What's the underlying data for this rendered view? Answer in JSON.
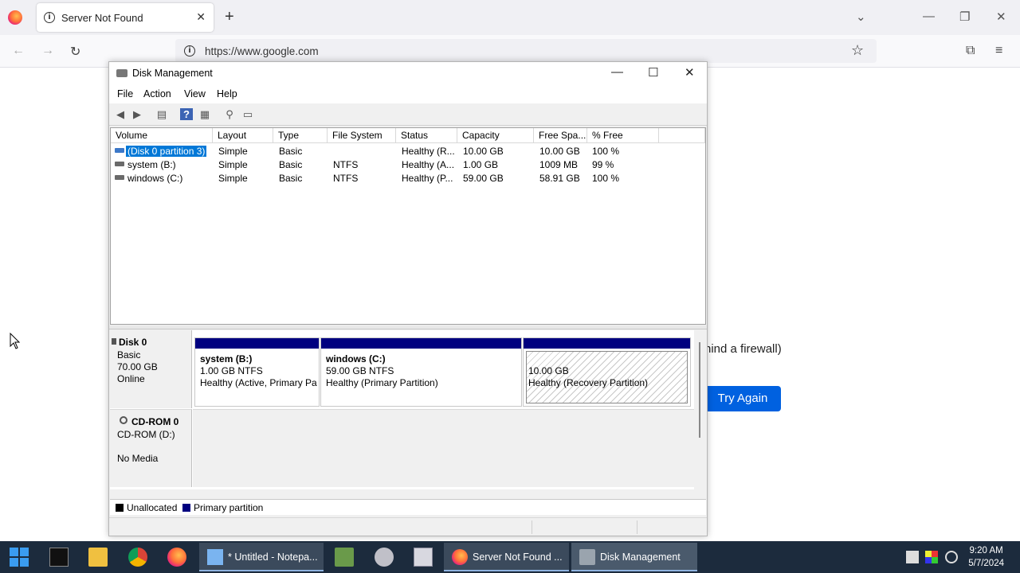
{
  "browser": {
    "tab_title": "Server Not Found",
    "url": "https://www.google.com",
    "page_fragment": "hind a firewall)",
    "try_again": "Try Again"
  },
  "window": {
    "title": "Disk Management",
    "menu": [
      "File",
      "Action",
      "View",
      "Help"
    ]
  },
  "volume_table": {
    "columns": [
      "Volume",
      "Layout",
      "Type",
      "File System",
      "Status",
      "Capacity",
      "Free Spa...",
      "% Free"
    ],
    "rows": [
      {
        "volume": "(Disk 0 partition 3)",
        "layout": "Simple",
        "type": "Basic",
        "fs": "",
        "status": "Healthy (R...",
        "capacity": "10.00 GB",
        "free": "10.00 GB",
        "pct": "100 %"
      },
      {
        "volume": "system (B:)",
        "layout": "Simple",
        "type": "Basic",
        "fs": "NTFS",
        "status": "Healthy (A...",
        "capacity": "1.00 GB",
        "free": "1009 MB",
        "pct": "99 %"
      },
      {
        "volume": "windows (C:)",
        "layout": "Simple",
        "type": "Basic",
        "fs": "NTFS",
        "status": "Healthy (P...",
        "capacity": "59.00 GB",
        "free": "58.91 GB",
        "pct": "100 %"
      }
    ]
  },
  "disks": {
    "disk0": {
      "name": "Disk 0",
      "kind": "Basic",
      "size": "70.00 GB",
      "state": "Online"
    },
    "partitions": [
      {
        "name": "system  (B:)",
        "detail": "1.00 GB NTFS",
        "status": "Healthy (Active, Primary Pa"
      },
      {
        "name": "windows  (C:)",
        "detail": "59.00 GB NTFS",
        "status": "Healthy (Primary Partition)"
      },
      {
        "name": "",
        "detail": "10.00 GB",
        "status": "Healthy (Recovery Partition)"
      }
    ],
    "cdrom": {
      "name": "CD-ROM 0",
      "drive": "CD-ROM (D:)",
      "media": "No Media"
    }
  },
  "legend": {
    "unallocated": "Unallocated",
    "primary": "Primary partition"
  },
  "colors": {
    "primary_partition": "#000080",
    "unallocated": "#000000",
    "selection": "#0078d7",
    "try_again": "#0061e0"
  },
  "taskbar": {
    "notepad": "* Untitled - Notepa...",
    "firefox": "Server Not Found ...",
    "diskmgmt": "Disk Management",
    "time": "9:20 AM",
    "date": "5/7/2024"
  }
}
